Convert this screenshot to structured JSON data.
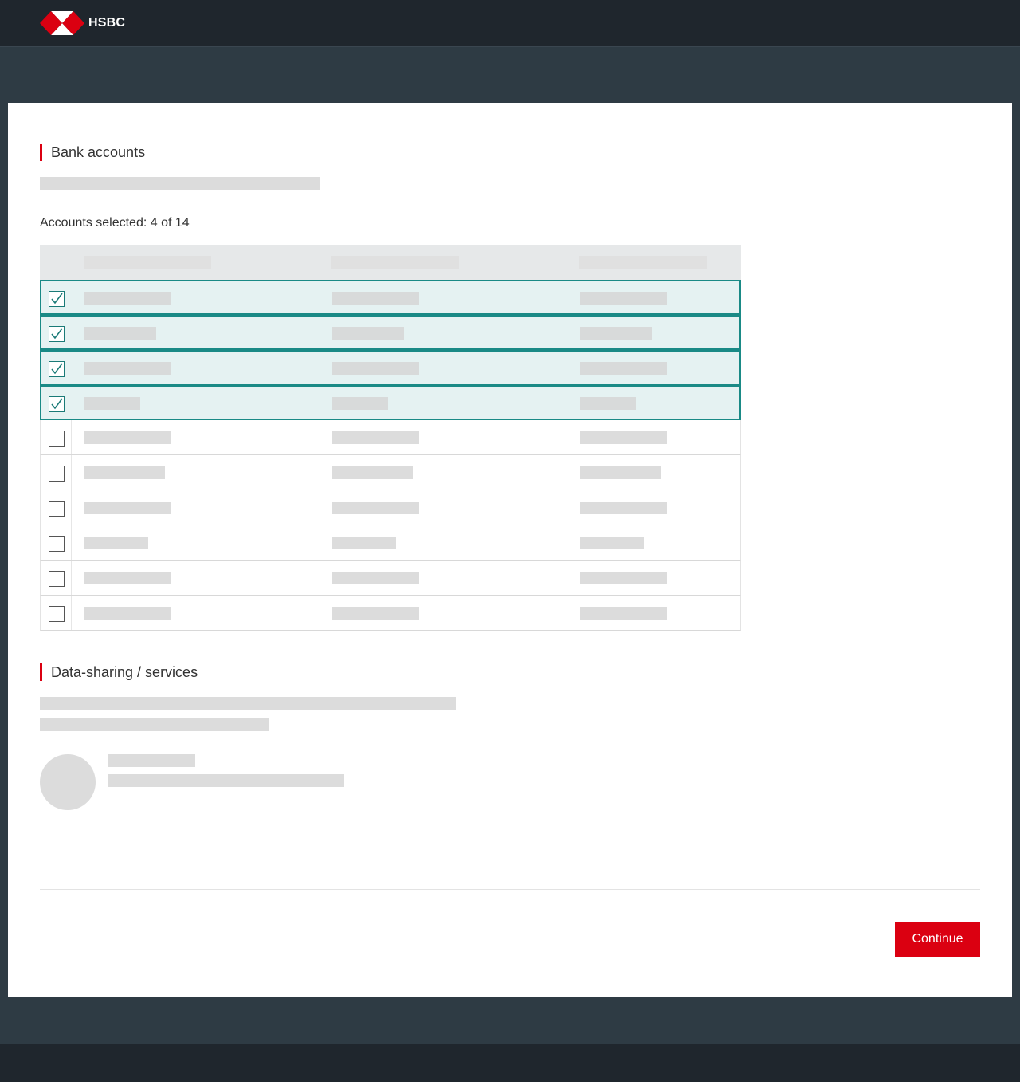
{
  "header": {
    "brand": "HSBC",
    "brand_colors": {
      "red": "#db0011",
      "white": "#ffffff"
    }
  },
  "bank_accounts": {
    "title": "Bank accounts",
    "accounts_selected": "Accounts selected: 4 of 14",
    "selected_count": 4,
    "total_count": 14,
    "rows": [
      {
        "checked": true
      },
      {
        "checked": true
      },
      {
        "checked": true
      },
      {
        "checked": true
      },
      {
        "checked": false
      },
      {
        "checked": false
      },
      {
        "checked": false
      },
      {
        "checked": false
      },
      {
        "checked": false
      },
      {
        "checked": false
      }
    ]
  },
  "data_sharing": {
    "title": "Data-sharing / services"
  },
  "actions": {
    "continue_label": "Continue"
  },
  "colors": {
    "accent_red": "#db0011",
    "selected_border": "#1a8a86",
    "selected_bg": "#e5f2f2",
    "page_bg": "#2e3b44",
    "topbar_bg": "#1f262d"
  }
}
